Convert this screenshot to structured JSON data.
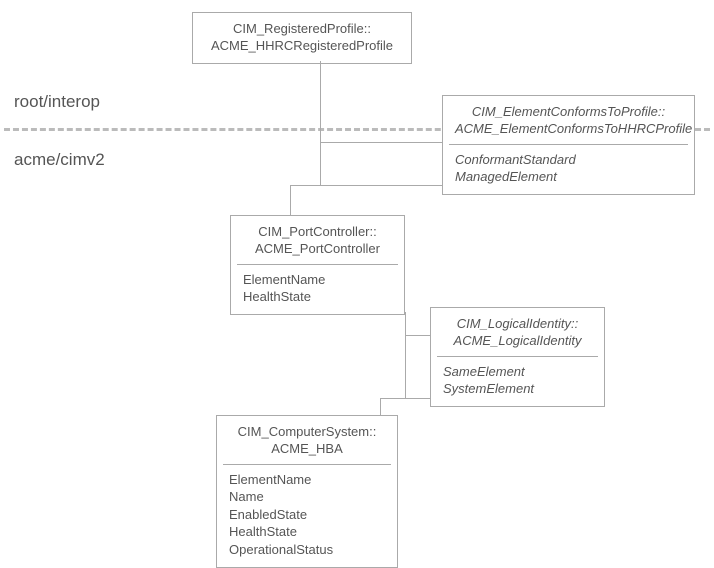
{
  "labels": {
    "root_interop": "root/interop",
    "acme_cimv2": "acme/cimv2"
  },
  "boxes": {
    "registered_profile": {
      "title_line1": "CIM_RegisteredProfile::",
      "title_line2": "ACME_HHRCRegisteredProfile"
    },
    "element_conforms": {
      "title_line1": "CIM_ElementConformsToProfile::",
      "title_line2": "ACME_ElementConformsToHHRCProfile",
      "attr1": "ConformantStandard",
      "attr2": "ManagedElement"
    },
    "port_controller": {
      "title_line1": "CIM_PortController::",
      "title_line2": "ACME_PortController",
      "attr1": "ElementName",
      "attr2": "HealthState"
    },
    "logical_identity": {
      "title_line1": "CIM_LogicalIdentity::",
      "title_line2": "ACME_LogicalIdentity",
      "attr1": "SameElement",
      "attr2": "SystemElement"
    },
    "computer_system": {
      "title_line1": "CIM_ComputerSystem::",
      "title_line2": "ACME_HBA",
      "attr1": "ElementName",
      "attr2": "Name",
      "attr3": "EnabledState",
      "attr4": "HealthState",
      "attr5": "OperationalStatus"
    }
  }
}
